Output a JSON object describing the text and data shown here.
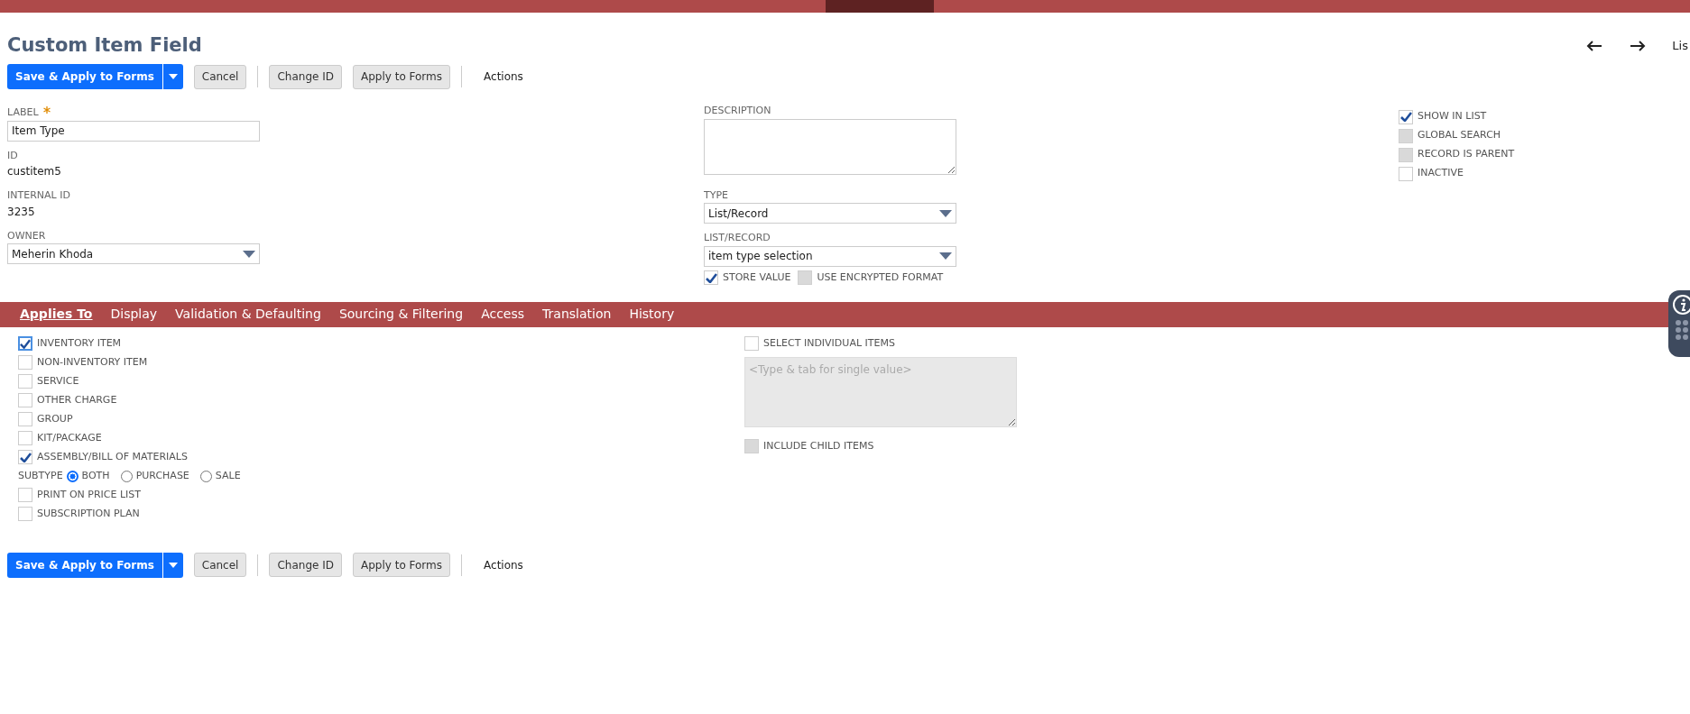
{
  "page_title": "Custom Item Field",
  "nav_arrows": [
    {
      "kind": "back"
    },
    {
      "kind": "forward"
    }
  ],
  "list_link": "Lis",
  "toolbar_top": {
    "primary": "Save & Apply to Forms",
    "buttons": [
      "Cancel",
      "Change ID",
      "Apply to Forms"
    ],
    "actions": "Actions"
  },
  "left_fields": [
    {
      "kind": "input",
      "label": "LABEL",
      "required": true,
      "value": "Item Type"
    },
    {
      "kind": "text",
      "label": "ID",
      "value": "custitem5"
    },
    {
      "kind": "text",
      "label": "INTERNAL ID",
      "value": "3235"
    },
    {
      "kind": "select",
      "label": "OWNER",
      "value": "Meherin Khoda"
    }
  ],
  "middle_fields": [
    {
      "kind": "textarea",
      "label": "DESCRIPTION"
    },
    {
      "kind": "select",
      "label": "TYPE",
      "value": "List/Record"
    },
    {
      "kind": "select",
      "label": "LIST/RECORD",
      "value": "item type selection"
    }
  ],
  "middle_checks": [
    {
      "label": "STORE VALUE",
      "checked": true,
      "disabled": false
    },
    {
      "label": "USE ENCRYPTED FORMAT",
      "checked": false,
      "disabled": true
    }
  ],
  "right_checks": [
    {
      "label": "SHOW IN LIST",
      "checked": true,
      "disabled": false
    },
    {
      "label": "GLOBAL SEARCH",
      "checked": false,
      "disabled": true
    },
    {
      "label": "RECORD IS PARENT",
      "checked": false,
      "disabled": true
    },
    {
      "label": "INACTIVE",
      "checked": false,
      "disabled": false
    }
  ],
  "tabs": [
    {
      "label": "Applies To",
      "selected": true
    },
    {
      "label": "Display",
      "selected": false
    },
    {
      "label": "Validation & Defaulting",
      "selected": false
    },
    {
      "label": "Sourcing & Filtering",
      "selected": false
    },
    {
      "label": "Access",
      "selected": false
    },
    {
      "label": "Translation",
      "selected": false
    },
    {
      "label": "History",
      "selected": false
    }
  ],
  "applies_to": [
    {
      "kind": "check",
      "label": "INVENTORY ITEM",
      "checked": true,
      "focused": true
    },
    {
      "kind": "check",
      "label": "NON-INVENTORY ITEM",
      "checked": false
    },
    {
      "kind": "check",
      "label": "SERVICE",
      "checked": false
    },
    {
      "kind": "check",
      "label": "OTHER CHARGE",
      "checked": false
    },
    {
      "kind": "check",
      "label": "GROUP",
      "checked": false
    },
    {
      "kind": "check",
      "label": "KIT/PACKAGE",
      "checked": false
    },
    {
      "kind": "check",
      "label": "ASSEMBLY/BILL OF MATERIALS",
      "checked": true
    },
    {
      "kind": "radios",
      "label": "SUBTYPE",
      "options": [
        {
          "label": "BOTH",
          "selected": true
        },
        {
          "label": "PURCHASE",
          "selected": false
        },
        {
          "label": "SALE",
          "selected": false
        }
      ]
    },
    {
      "kind": "check",
      "label": "PRINT ON PRICE LIST",
      "checked": false
    },
    {
      "kind": "check",
      "label": "SUBSCRIPTION PLAN",
      "checked": false
    }
  ],
  "items_panel": {
    "select_label": "SELECT INDIVIDUAL ITEMS",
    "select_checked": false,
    "placeholder": "<Type & tab for single value>",
    "child_label": "INCLUDE CHILD ITEMS",
    "child_checked": false,
    "child_disabled": true
  },
  "toolbar_bottom": {
    "primary": "Save & Apply to Forms",
    "buttons": [
      "Cancel",
      "Change ID",
      "Apply to Forms"
    ],
    "actions": "Actions"
  }
}
